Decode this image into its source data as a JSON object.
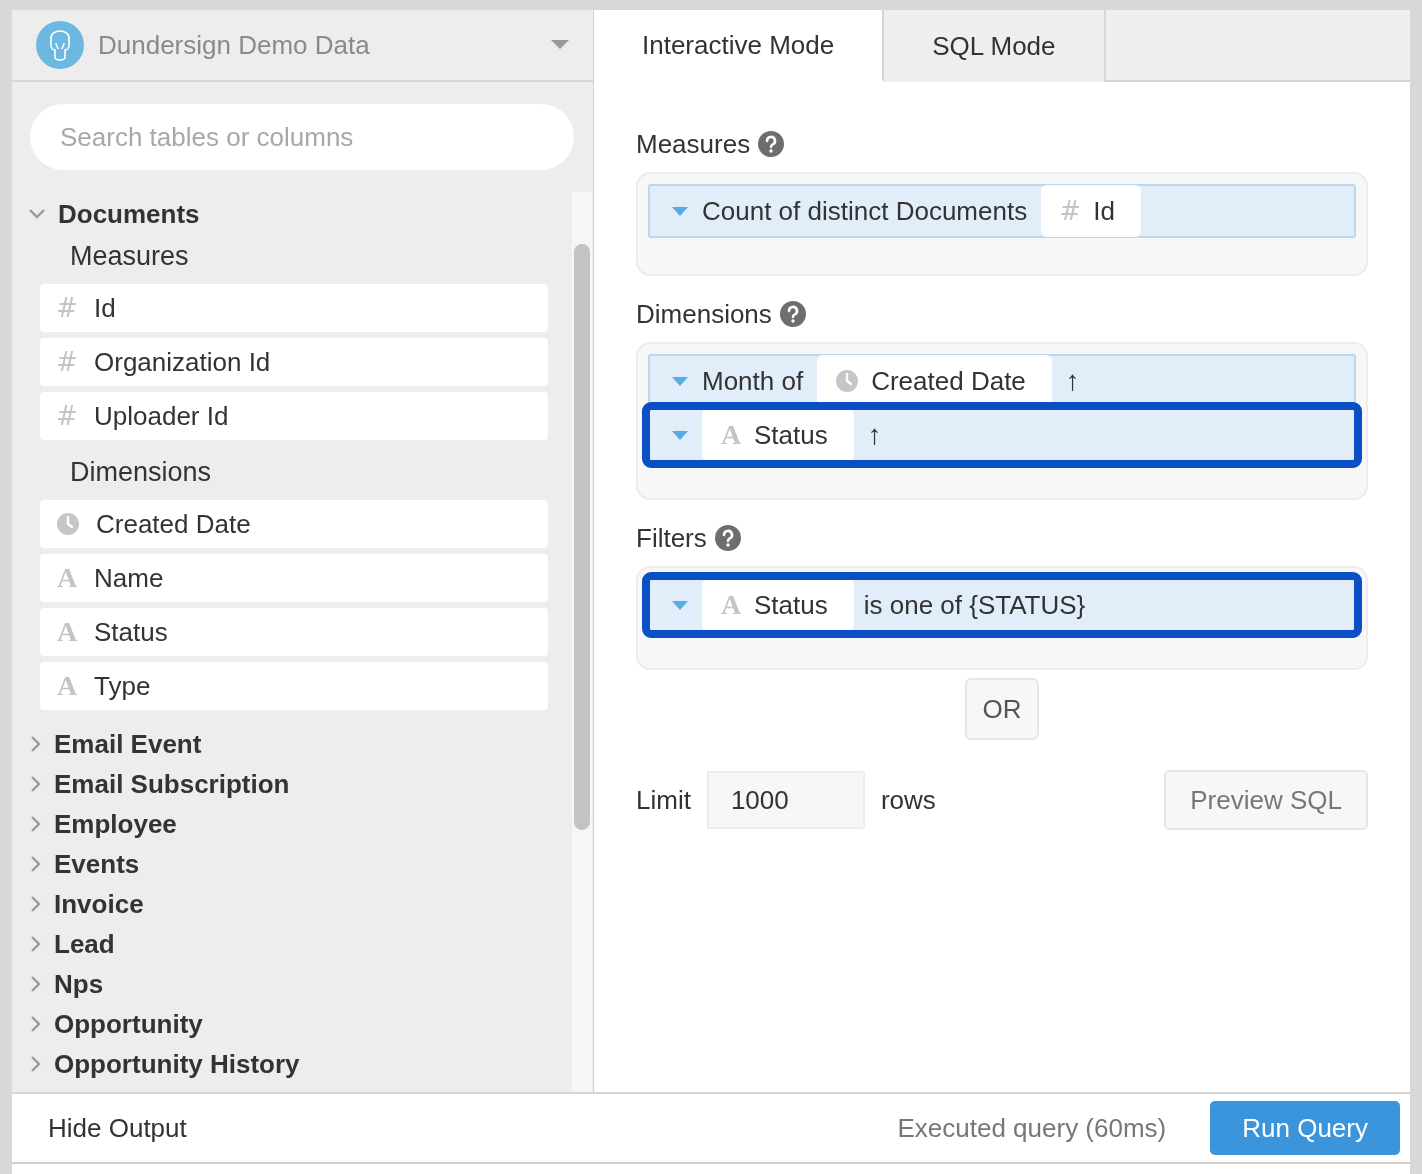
{
  "datasource": {
    "name": "Dundersign Demo Data"
  },
  "search": {
    "placeholder": "Search tables or columns"
  },
  "tables": [
    {
      "name": "Documents",
      "expanded": true,
      "groups": [
        {
          "title": "Measures",
          "fields": [
            {
              "kind": "number",
              "icon": "#",
              "name": "Id"
            },
            {
              "kind": "number",
              "icon": "#",
              "name": "Organization Id"
            },
            {
              "kind": "number",
              "icon": "#",
              "name": "Uploader Id"
            }
          ]
        },
        {
          "title": "Dimensions",
          "fields": [
            {
              "kind": "date",
              "name": "Created Date"
            },
            {
              "kind": "text",
              "icon": "A",
              "name": "Name"
            },
            {
              "kind": "text",
              "icon": "A",
              "name": "Status"
            },
            {
              "kind": "text",
              "icon": "A",
              "name": "Type"
            }
          ]
        }
      ]
    },
    {
      "name": "Email Event",
      "expanded": false
    },
    {
      "name": "Email Subscription",
      "expanded": false
    },
    {
      "name": "Employee",
      "expanded": false
    },
    {
      "name": "Events",
      "expanded": false
    },
    {
      "name": "Invoice",
      "expanded": false
    },
    {
      "name": "Lead",
      "expanded": false
    },
    {
      "name": "Nps",
      "expanded": false
    },
    {
      "name": "Opportunity",
      "expanded": false
    },
    {
      "name": "Opportunity History",
      "expanded": false
    }
  ],
  "tabs": [
    {
      "label": "Interactive Mode",
      "selected": true
    },
    {
      "label": "SQL Mode",
      "selected": false
    }
  ],
  "sections": [
    {
      "label": "Measures",
      "items": [
        {
          "prefix": "Count of distinct Documents",
          "field": {
            "kind": "number",
            "icon": "#",
            "name": "Id"
          },
          "highlighted": false
        }
      ]
    },
    {
      "label": "Dimensions",
      "items": [
        {
          "prefix": "Month of",
          "field": {
            "kind": "date",
            "name": "Created Date"
          },
          "sort": "↑",
          "highlighted": false
        },
        {
          "field": {
            "kind": "text",
            "icon": "A",
            "name": "Status"
          },
          "sort": "↑",
          "highlighted": true
        }
      ]
    },
    {
      "label": "Filters",
      "items": [
        {
          "field": {
            "kind": "text",
            "icon": "A",
            "name": "Status"
          },
          "condition": "is one of {STATUS}",
          "highlighted": true
        }
      ]
    }
  ],
  "or_button": "OR",
  "limit": {
    "label": "Limit",
    "value": "1000",
    "unit": "rows"
  },
  "preview_button": "Preview SQL",
  "footer": {
    "hide_output": "Hide Output",
    "status": "Executed query (60ms)",
    "run_button": "Run Query"
  }
}
